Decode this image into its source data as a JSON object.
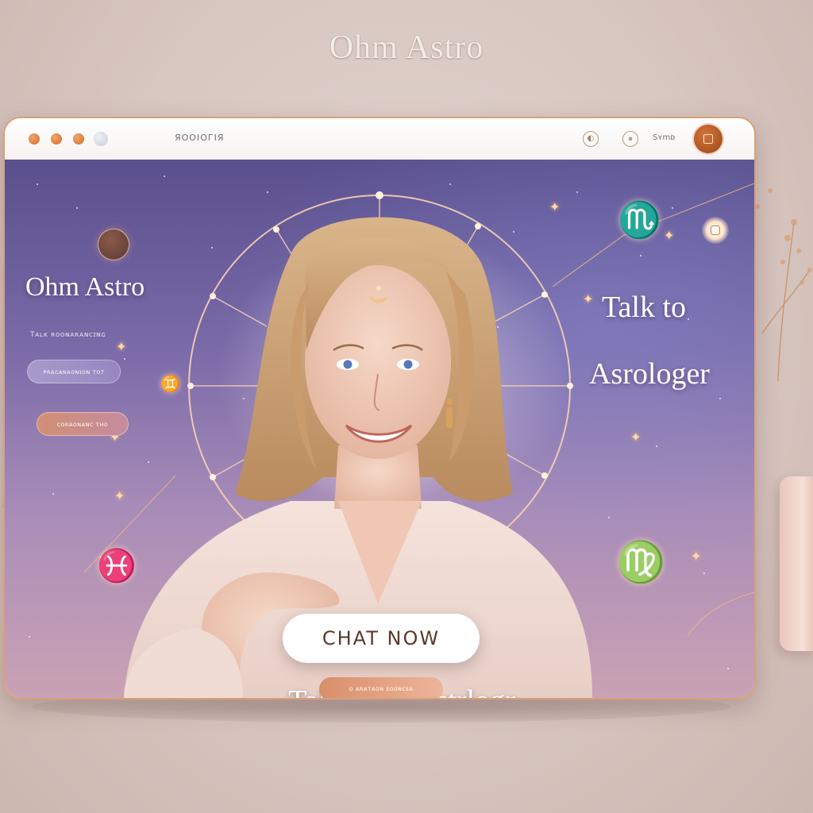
{
  "page": {
    "brand_title": "Ohm Astro"
  },
  "titlebar": {
    "url": "ЯООІОГІЯ",
    "label": "Ѕʏmᴅ"
  },
  "hero": {
    "brand": "Ohm Astro",
    "tiny_link": "Tᴀʟᴋ ʀᴏᴏɴᴀʀᴀɴᴄɪɴɢ",
    "pill_1_label": "ᴘʀᴀᴄᴀɴᴀᴏɴɪᴏɴ ᴛᴏᴛ",
    "pill_2_label": "ᴄᴏʀᴀᴏɴᴀɴᴄ ᴛʜᴏ",
    "heading_line_1": "Talk to",
    "heading_line_2": "Asrologer",
    "chat_button": "CHAT NOW",
    "subtitle": "Talk to an Astrlogr",
    "pill_3_label": "ᴏ ᴀʀᴀᴛᴀᴏɴ   ᴇᴏᴏɴᴄᴇᴀ"
  },
  "zodiac": {
    "scorpio": "♏",
    "virgo": "♍",
    "pisces": "♓",
    "gemini": "♊"
  },
  "colors": {
    "accent": "#d08f6a",
    "window_border": "#d8a178",
    "sky_top": "#5a4f8e",
    "sky_bottom": "#caa2b4"
  },
  "icons": [
    "moon-icon",
    "spiral-icon",
    "avatar-icon",
    "glow-square-icon",
    "sparkle-icon"
  ]
}
